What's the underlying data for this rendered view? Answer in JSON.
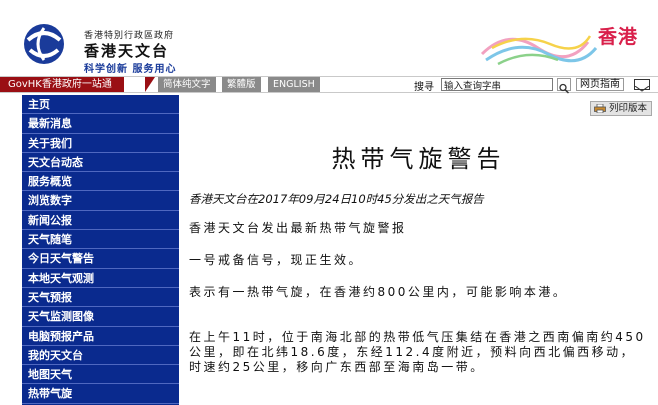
{
  "header": {
    "org_small": "香港特別行政區政府",
    "org_title": "香港天文台",
    "slogan": "科学创新  服务用心",
    "brand_text": "香港"
  },
  "topbar": {
    "govhk": "GovHK香港政府一站通",
    "lang_simplified": "简体纯文字",
    "lang_traditional": "繁體版",
    "lang_english": "ENGLISH",
    "search_label": "搜寻",
    "search_value": "输入查询字串",
    "guide": "网页指南"
  },
  "sidebar": {
    "items": [
      "主页",
      "最新消息",
      "关于我们",
      "天文台动态",
      "服务概览",
      "浏览数字",
      "新闻公报",
      "天气随笔",
      "今日天气警告",
      "本地天气观测",
      "天气预报",
      "天气监测图像",
      "电脑预报产品",
      "我的天文台",
      "地图天气",
      "热带气旋"
    ]
  },
  "main": {
    "print_label": "列印版本",
    "title": "热带气旋警告",
    "issued": "香港天文台在2017年09月24日10时45分发出之天气报告",
    "p1": "香港天文台发出最新热带气旋警报",
    "p2": "一号戒备信号，现正生效。",
    "p3": "表示有一热带气旋，在香港约800公里内，可能影响本港。",
    "p4": "在上午11时，位于南海北部的热带低气压集结在香港之西南偏南约450公里，即在北纬18.6度，东经112.4度附近，预料向西北偏西移动，时速约25公里，移向广东西部至海南岛一带。"
  },
  "colors": {
    "sidebar_bg": "#0a2a8e",
    "govhk_bg": "#9a0f14",
    "brand_pink": "#d9204b",
    "logo_blue": "#1a3b9a"
  },
  "icons": [
    "observatory-logo-icon",
    "search-icon",
    "mail-icon",
    "print-icon"
  ]
}
